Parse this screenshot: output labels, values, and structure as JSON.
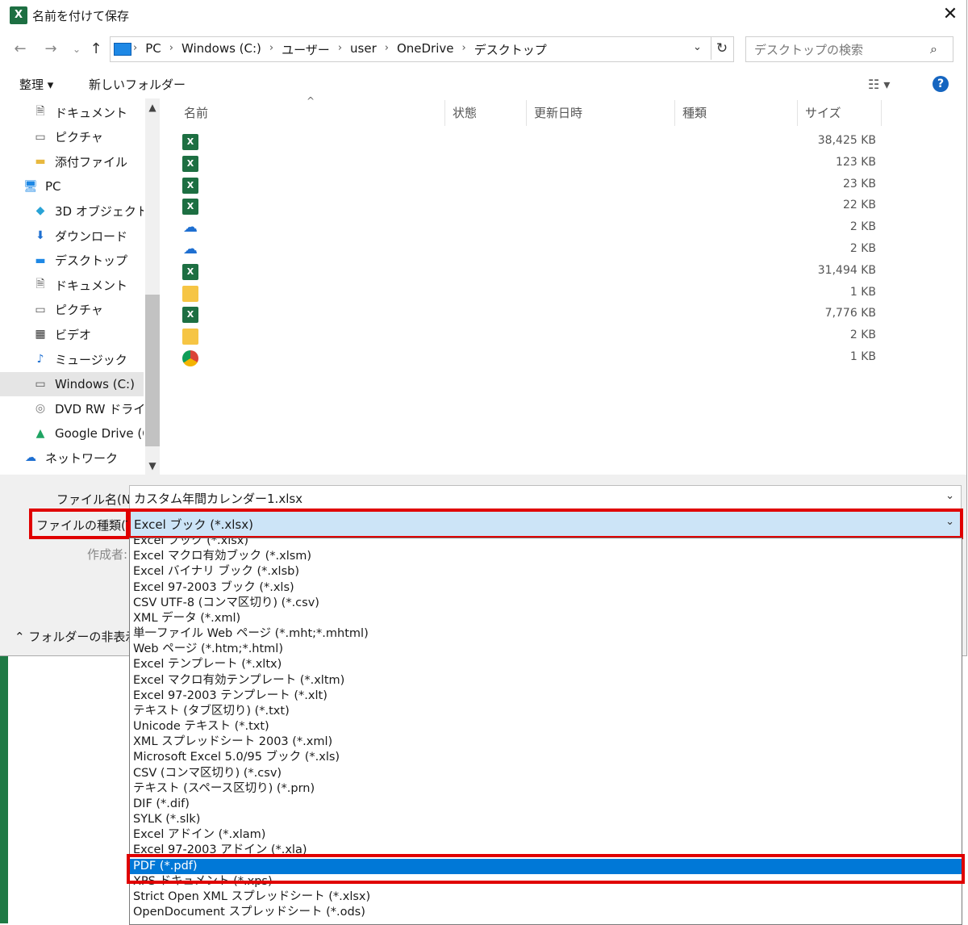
{
  "window": {
    "title": "名前を付けて保存",
    "app_icon": "X",
    "close": "✕"
  },
  "address": {
    "crumbs": [
      "PC",
      "Windows (C:)",
      "ユーザー",
      "user",
      "OneDrive",
      "デスクトップ"
    ],
    "separator": "›",
    "search_placeholder": "デスクトップの検索"
  },
  "toolbar": {
    "organize": "整理 ▾",
    "new_folder": "新しいフォルダー",
    "view_icon": "☷ ▾",
    "help": "?"
  },
  "nav": {
    "items": [
      {
        "label": "ドキュメント",
        "icon": "document-icon"
      },
      {
        "label": "ピクチャ",
        "icon": "pictures-icon"
      },
      {
        "label": "添付ファイル",
        "icon": "folder-icon"
      },
      {
        "label": "PC",
        "icon": "pc-icon"
      },
      {
        "label": "3D オブジェクト",
        "icon": "3d-objects-icon"
      },
      {
        "label": "ダウンロード",
        "icon": "download-icon"
      },
      {
        "label": "デスクトップ",
        "icon": "desktop-icon"
      },
      {
        "label": "ドキュメント",
        "icon": "document-icon"
      },
      {
        "label": "ピクチャ",
        "icon": "pictures-icon"
      },
      {
        "label": "ビデオ",
        "icon": "video-icon"
      },
      {
        "label": "ミュージック",
        "icon": "music-icon"
      },
      {
        "label": "Windows (C:)",
        "icon": "drive-icon"
      },
      {
        "label": "DVD RW ドライブ (",
        "icon": "dvd-icon"
      },
      {
        "label": "Google Drive (G:",
        "icon": "google-drive-icon"
      },
      {
        "label": "ネットワーク",
        "icon": "network-icon"
      }
    ]
  },
  "list": {
    "columns": [
      "名前",
      "状態",
      "更新日時",
      "種類",
      "サイズ"
    ],
    "files": [
      {
        "type": "excel",
        "size": "38,425 KB"
      },
      {
        "type": "excel",
        "size": "123 KB"
      },
      {
        "type": "excel",
        "size": "23 KB"
      },
      {
        "type": "excel",
        "size": "22 KB"
      },
      {
        "type": "cloud",
        "size": "2 KB"
      },
      {
        "type": "cloud",
        "size": "2 KB"
      },
      {
        "type": "excel",
        "size": "31,494 KB"
      },
      {
        "type": "folder",
        "size": "1 KB"
      },
      {
        "type": "excel",
        "size": "7,776 KB"
      },
      {
        "type": "folder",
        "size": "2 KB"
      },
      {
        "type": "chrome",
        "size": "1 KB"
      }
    ]
  },
  "form": {
    "filename_label": "ファイル名(N):",
    "filename_value": "カスタム年間カレンダー1.xlsx",
    "filetype_label": "ファイルの種類(T):",
    "filetype_value": "Excel ブック (*.xlsx)",
    "author_label": "作成者:",
    "hide_folders": "フォルダーの非表示"
  },
  "filetype_options": [
    "Excel ブック (*.xlsx)",
    "Excel マクロ有効ブック (*.xlsm)",
    "Excel バイナリ ブック (*.xlsb)",
    "Excel 97-2003 ブック (*.xls)",
    "CSV UTF-8 (コンマ区切り) (*.csv)",
    "XML データ (*.xml)",
    "単一ファイル Web ページ (*.mht;*.mhtml)",
    "Web ページ (*.htm;*.html)",
    "Excel テンプレート (*.xltx)",
    "Excel マクロ有効テンプレート (*.xltm)",
    "Excel 97-2003 テンプレート (*.xlt)",
    "テキスト (タブ区切り) (*.txt)",
    "Unicode テキスト (*.txt)",
    "XML スプレッドシート 2003 (*.xml)",
    "Microsoft Excel 5.0/95 ブック (*.xls)",
    "CSV (コンマ区切り) (*.csv)",
    "テキスト (スペース区切り) (*.prn)",
    "DIF (*.dif)",
    "SYLK (*.slk)",
    "Excel アドイン (*.xlam)",
    "Excel 97-2003 アドイン (*.xla)",
    "PDF (*.pdf)",
    "XPS ドキュメント (*.xps)",
    "Strict Open XML スプレッドシート (*.xlsx)",
    "OpenDocument スプレッドシート (*.ods)"
  ],
  "selected_option_index": 21,
  "colors": {
    "highlight": "#e00000",
    "selection": "#0078d7",
    "excel_green": "#1d6f42"
  }
}
